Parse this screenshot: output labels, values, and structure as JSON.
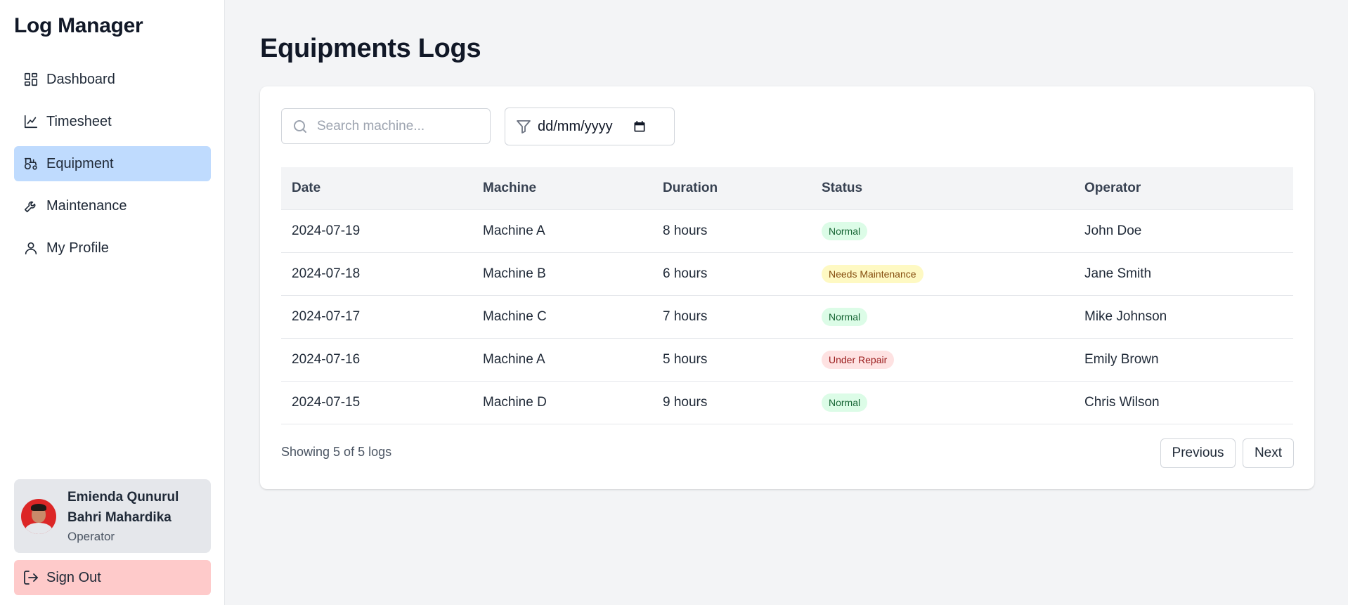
{
  "app": {
    "title": "Log Manager"
  },
  "sidebar": {
    "items": [
      {
        "label": "Dashboard",
        "icon": "dashboard-icon",
        "active": false
      },
      {
        "label": "Timesheet",
        "icon": "chart-line-icon",
        "active": false
      },
      {
        "label": "Equipment",
        "icon": "tractor-icon",
        "active": true
      },
      {
        "label": "Maintenance",
        "icon": "wrench-icon",
        "active": false
      },
      {
        "label": "My Profile",
        "icon": "user-icon",
        "active": false
      }
    ],
    "user": {
      "name_line1": "Emienda Qunurul",
      "name_line2": "Bahri Mahardika",
      "role": "Operator"
    },
    "signout_label": "Sign Out"
  },
  "main": {
    "title": "Equipments Logs",
    "search": {
      "placeholder": "Search machine...",
      "value": ""
    },
    "date_filter": {
      "placeholder": "dd/mm/yyyy"
    },
    "table": {
      "columns": [
        "Date",
        "Machine",
        "Duration",
        "Status",
        "Operator"
      ],
      "rows": [
        {
          "date": "2024-07-19",
          "machine": "Machine A",
          "duration": "8 hours",
          "status": "Normal",
          "status_type": "normal",
          "operator": "John Doe"
        },
        {
          "date": "2024-07-18",
          "machine": "Machine B",
          "duration": "6 hours",
          "status": "Needs Maintenance",
          "status_type": "maint",
          "operator": "Jane Smith"
        },
        {
          "date": "2024-07-17",
          "machine": "Machine C",
          "duration": "7 hours",
          "status": "Normal",
          "status_type": "normal",
          "operator": "Mike Johnson"
        },
        {
          "date": "2024-07-16",
          "machine": "Machine A",
          "duration": "5 hours",
          "status": "Under Repair",
          "status_type": "repair",
          "operator": "Emily Brown"
        },
        {
          "date": "2024-07-15",
          "machine": "Machine D",
          "duration": "9 hours",
          "status": "Normal",
          "status_type": "normal",
          "operator": "Chris Wilson"
        }
      ]
    },
    "pagination": {
      "summary": "Showing 5 of 5 logs",
      "prev_label": "Previous",
      "next_label": "Next"
    }
  },
  "colors": {
    "active_nav": "#bfdbfe",
    "signout_bg": "#fecaca",
    "badge_normal": "#dcfce7",
    "badge_maint": "#fef9c3",
    "badge_repair": "#fee2e2"
  }
}
